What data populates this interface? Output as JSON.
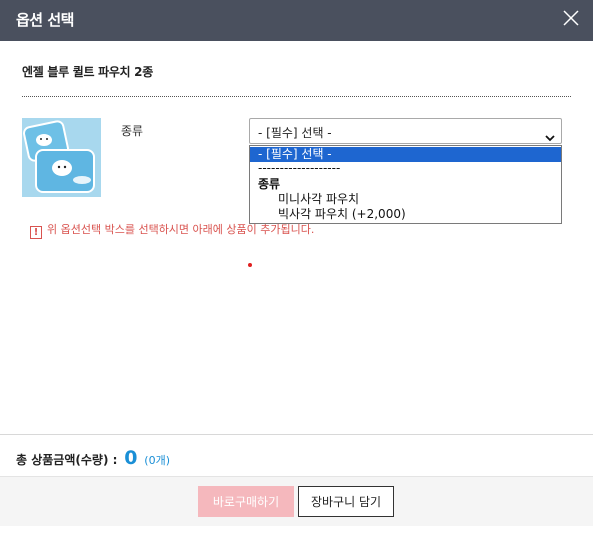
{
  "header": {
    "title": "옵션 선택",
    "close_icon": "close-icon"
  },
  "product": {
    "name": "엔젤 블루 퀼트 파우치 2종",
    "image_icon": "product-thumbnail"
  },
  "option": {
    "label": "종류",
    "selected": "- [필수] 선택 -",
    "dropdown": {
      "placeholder": "- [필수] 선택 -",
      "separator": "-------------------",
      "group": "종류",
      "items": [
        "미니사각 파우치",
        "빅사각 파우치 (+2,000)"
      ]
    }
  },
  "notice": {
    "icon_symbol": "!",
    "text": "위 옵션선택 박스를 선택하시면 아래에 상품이 추가됩니다."
  },
  "total": {
    "label": "총 상품금액(수량) :",
    "amount": "0",
    "count": "(0개)"
  },
  "buttons": {
    "buy_now": "바로구매하기",
    "add_cart": "장바구니 담기"
  },
  "colors": {
    "header_bg": "#4a505e",
    "accent_blue": "#1a8fd6",
    "buy_button_bg": "#f5b8bd",
    "notice_red": "#d9534f",
    "dropdown_highlight": "#1e66d0"
  }
}
